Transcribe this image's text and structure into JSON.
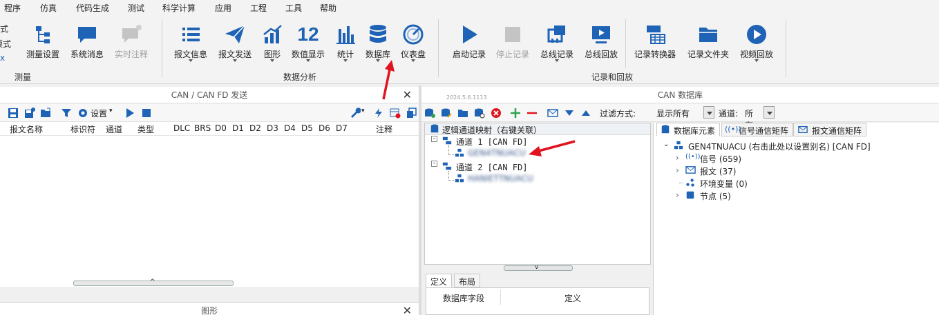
{
  "menu": [
    "程序",
    "仿真",
    "代码生成",
    "测试",
    "科学计算",
    "应用",
    "工程",
    "工具",
    "帮助"
  ],
  "ribbon": {
    "left_cut": [
      "式",
      "模式",
      "x"
    ],
    "groups": [
      {
        "label": "测量"
      },
      {
        "label": "数据分析"
      },
      {
        "label": "记录和回放"
      }
    ],
    "buttons": {
      "measure_settings": "测量设置",
      "system_messages": "系统消息",
      "realtime_comment": "实时注释",
      "msg_info": "报文信息",
      "msg_send": "报文发送",
      "graph": "图形",
      "numeric": "数值显示",
      "numeric_glyph": "12",
      "stats": "统计",
      "database": "数据库",
      "dashboard": "仪表盘",
      "start_rec": "启动记录",
      "stop_rec": "停止记录",
      "bus_rec": "总线记录",
      "offline_replay": "总线回放",
      "rec_converter": "记录转换器",
      "rec_folder": "记录文件夹",
      "video_replay": "视频回放"
    }
  },
  "left_pane": {
    "title": "CAN / CAN FD 发送",
    "settings_label": "设置",
    "columns": [
      "报文名称",
      "标识符",
      "通道",
      "类型",
      "DLC",
      "BRS",
      "D0",
      "D1",
      "D2",
      "D3",
      "D4",
      "D5",
      "D6",
      "D7",
      "注释"
    ],
    "bottom_title": "图形"
  },
  "right_pane": {
    "title": "CAN 数据库",
    "version": "2024.5.6.1113",
    "filter_label": "过滤方式:",
    "filter_value": "显示所有",
    "channel_label": "通道:",
    "channel_value": "所有",
    "mapping_header": "逻辑通道映射（右键关联）",
    "channels": [
      {
        "label": "通道 1 [CAN FD]",
        "child": "GEN4TNUACU"
      },
      {
        "label": "通道 2 [CAN FD]",
        "child": "HANIETTNUACU"
      }
    ],
    "tabs": [
      "数据库元素",
      "信号通信矩阵",
      "报文通信矩阵"
    ],
    "db_root": "GEN4TNUACU (右击此处以设置别名) [CAN FD]",
    "db_items": [
      {
        "label": "信号 (659)",
        "icon": "signal-icon"
      },
      {
        "label": "报文 (37)",
        "icon": "envelope-icon"
      },
      {
        "label": "环境变量 (0)",
        "icon": "env-var-icon"
      },
      {
        "label": "节点 (5)",
        "icon": "node-icon"
      }
    ],
    "bottom_tabs": [
      "定义",
      "布局"
    ],
    "def_columns": [
      "数据库字段",
      "定义"
    ]
  },
  "colors": {
    "accent_blue": "#1e63b5",
    "annotation_red": "#e0141e"
  }
}
